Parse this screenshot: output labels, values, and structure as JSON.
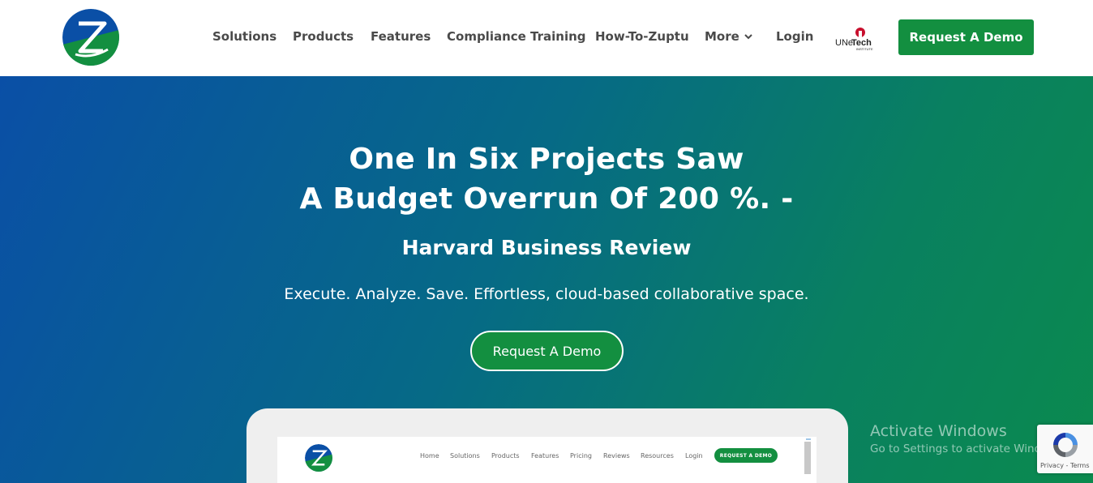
{
  "header": {
    "logo_icon": "zuptu-logo-icon",
    "nav": {
      "solutions": "Solutions",
      "products": "Products",
      "features": "Features",
      "compliance": "Compliance Training",
      "howto": "How-To-Zuptu",
      "more": "More",
      "login": "Login"
    },
    "partner_logo": {
      "text_a": "UNe",
      "text_b": "Tech",
      "text_c": "INSTITUTE"
    },
    "cta_label": "Request A Demo"
  },
  "hero": {
    "title_line1": "One In Six Projects Saw",
    "title_line2": "A Budget Overrun Of 200 %. -",
    "source": "Harvard Business Review",
    "tagline": "Execute. Analyze. Save. Effortless, cloud-based collaborative space.",
    "cta_label": "Request A Demo"
  },
  "mockup": {
    "nav": [
      "Home",
      "Solutions",
      "Products",
      "Features",
      "Pricing",
      "Reviews",
      "Resources",
      "Login"
    ],
    "cta_label": "REQUEST A DEMO"
  },
  "watermark": {
    "line1": "Activate Windows",
    "line2": "Go to Settings to activate Windows."
  },
  "recaptcha": {
    "text": "Privacy - Terms"
  },
  "colors": {
    "brand_green": "#138f40",
    "brand_blue": "#0a4fa6",
    "hero_gradient_end": "#0b8a4e"
  }
}
